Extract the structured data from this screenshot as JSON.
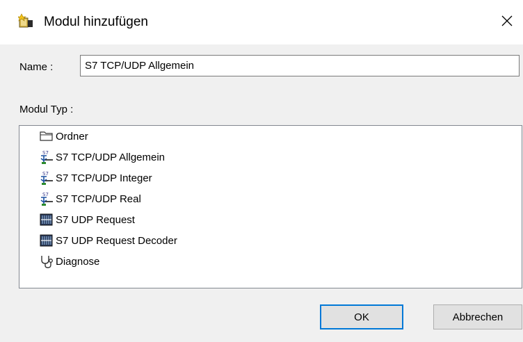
{
  "dialog": {
    "title": "Modul hinzufügen",
    "close_symbol": "✕"
  },
  "form": {
    "name_label": "Name :",
    "name_value": "S7 TCP/UDP Allgemein",
    "type_label": "Modul Typ :"
  },
  "module_types": [
    {
      "label": "Ordner",
      "icon": "folder-icon"
    },
    {
      "label": "S7 TCP/UDP Allgemein",
      "icon": "s7-network-icon"
    },
    {
      "label": "S7 TCP/UDP Integer",
      "icon": "s7-network-icon"
    },
    {
      "label": "S7 TCP/UDP Real",
      "icon": "s7-network-icon"
    },
    {
      "label": "S7 UDP Request",
      "icon": "s7-module-icon"
    },
    {
      "label": "S7 UDP Request Decoder",
      "icon": "s7-module-icon"
    },
    {
      "label": "Diagnose",
      "icon": "stethoscope-icon"
    }
  ],
  "buttons": {
    "ok": "OK",
    "cancel": "Abbrechen"
  },
  "colors": {
    "accent": "#0078d7",
    "window_bg": "#f0f0f0"
  }
}
